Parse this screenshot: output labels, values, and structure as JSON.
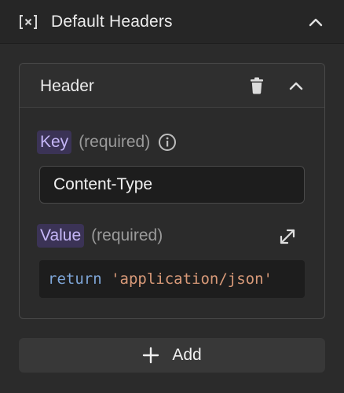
{
  "section": {
    "title": "Default Headers",
    "icon": "variable-brackets-icon",
    "collapse_icon": "chevron-up-icon"
  },
  "header_card": {
    "title": "Header",
    "delete_icon": "trash-icon",
    "collapse_icon": "chevron-up-icon",
    "key_field": {
      "label": "Key",
      "required_text": "(required)",
      "info_icon": "info-icon",
      "value": "Content-Type"
    },
    "value_field": {
      "label": "Value",
      "required_text": "(required)",
      "expand_icon": "expand-icon",
      "code_keyword": "return",
      "code_string": "'application/json'"
    }
  },
  "add_button": {
    "label": "Add",
    "icon": "plus-icon"
  },
  "colors": {
    "background": "#2b2b2b",
    "label_chip_bg": "#3b3356",
    "label_chip_text": "#c5b6f7",
    "code_keyword": "#7fa7d9",
    "code_string": "#d99a79"
  }
}
